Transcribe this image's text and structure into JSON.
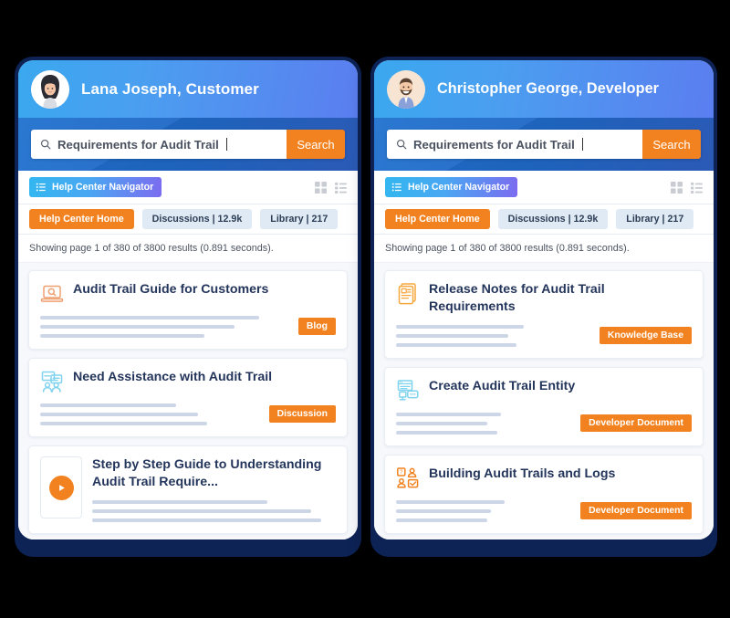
{
  "theme": {
    "frame_color": "#0d2255",
    "page_background": "#000000",
    "accent_orange": "#f2821f",
    "header_blue": "#3aa8ef",
    "search_band_blue": "#1f6fd0",
    "title_navy": "#24355c",
    "tab_idle_blue": "#dfeaf4"
  },
  "panels": [
    {
      "id": "customer-panel",
      "user": {
        "name": "Lana Joseph, Customer",
        "avatar": "female-avatar"
      },
      "search": {
        "value": "Requirements for Audit Trail",
        "placeholder": "Requirements for Audit Trail",
        "button_label": "Search",
        "icon": "search-icon"
      },
      "navigator": {
        "label": "Help Center Navigator",
        "icon": "list-bullets-icon"
      },
      "view_toggles": [
        {
          "name": "grid-view-icon"
        },
        {
          "name": "list-view-icon"
        }
      ],
      "tabs": [
        {
          "label": "Help Center Home",
          "active": true
        },
        {
          "label": "Discussions | 12.9k",
          "active": false
        },
        {
          "label": "Library | 217",
          "active": false
        }
      ],
      "results_meta": "Showing page 1 of 380 of 3800 results (0.891 seconds).",
      "results": [
        {
          "title": "Audit Trail Guide for Customers",
          "badge": "Blog",
          "icon": "laptop-search-icon",
          "icon_color": "#f0a070",
          "type": "standard",
          "line_widths": [
            88,
            78,
            66
          ]
        },
        {
          "title": "Need Assistance with Audit Trail",
          "badge": "Discussion",
          "icon": "discussion-people-icon",
          "icon_color": "#7fd3ee",
          "type": "standard",
          "line_widths": [
            62,
            72,
            76
          ]
        },
        {
          "title": "Step by Step Guide to Understanding Audit Trail Require...",
          "badge": "",
          "icon": "play-video-icon",
          "icon_color": "#f2821f",
          "type": "video",
          "line_widths": [
            72,
            90,
            94
          ]
        }
      ]
    },
    {
      "id": "developer-panel",
      "user": {
        "name": "Christopher George, Developer",
        "avatar": "male-avatar"
      },
      "search": {
        "value": "Requirements for Audit Trail",
        "placeholder": "Requirements for Audit Trail",
        "button_label": "Search",
        "icon": "search-icon"
      },
      "navigator": {
        "label": "Help Center Navigator",
        "icon": "list-bullets-icon"
      },
      "view_toggles": [
        {
          "name": "grid-view-icon"
        },
        {
          "name": "list-view-icon"
        }
      ],
      "tabs": [
        {
          "label": "Help Center Home",
          "active": true
        },
        {
          "label": "Discussions | 12.9k",
          "active": false
        },
        {
          "label": "Library | 217",
          "active": false
        }
      ],
      "results_meta": "Showing page 1 of 380 of 3800 results (0.891 seconds).",
      "results": [
        {
          "title": "Release Notes for Audit Trail Requirements",
          "badge": "Knowledge Base",
          "icon": "release-notes-document-icon",
          "icon_color": "#f6a83f",
          "type": "standard",
          "line_widths": [
            66,
            58,
            62
          ]
        },
        {
          "title": "Create Audit Trail Entity",
          "badge": "Developer Document",
          "icon": "entity-browser-icon",
          "icon_color": "#7fd3ee",
          "type": "standard",
          "line_widths": [
            60,
            52,
            58
          ]
        },
        {
          "title": "Building Audit Trails and Logs",
          "badge": "Developer Document",
          "icon": "community-support-icon",
          "icon_color": "#f2821f",
          "type": "standard",
          "line_widths": [
            62,
            54,
            52
          ]
        }
      ]
    }
  ]
}
